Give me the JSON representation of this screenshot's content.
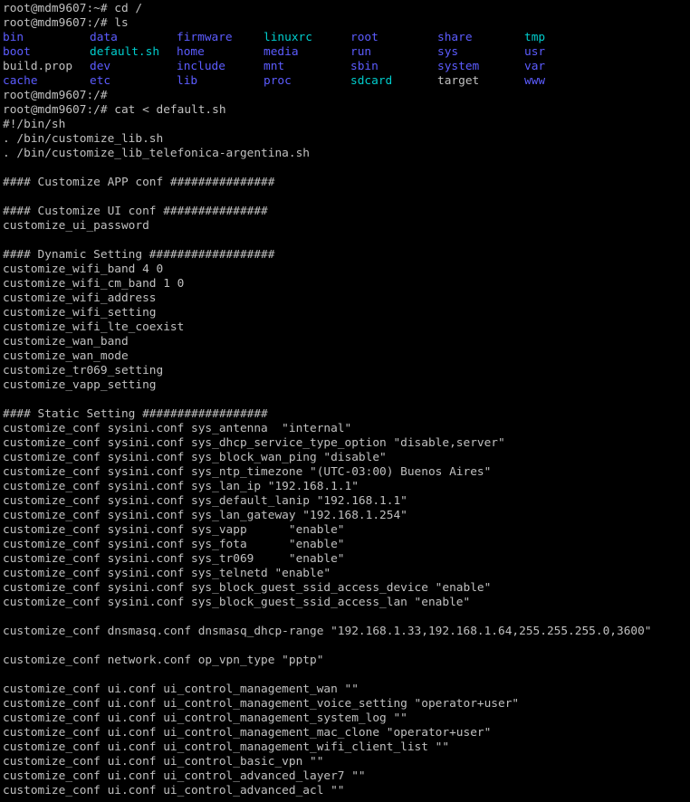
{
  "colors": {
    "background": "#000000",
    "text": "#c0c0c0",
    "directory": "#5c5cff",
    "executable": "#00cdcd",
    "symlink": "#00cdcd",
    "linkfile": "#00cdcd"
  },
  "session": [
    "root@mdm9607:~# cd /",
    "root@mdm9607:/# ls"
  ],
  "ls": {
    "rows": [
      [
        {
          "name": "bin",
          "kind": "dir"
        },
        {
          "name": "data",
          "kind": "dir"
        },
        {
          "name": "firmware",
          "kind": "dir"
        },
        {
          "name": "linuxrc",
          "kind": "link"
        },
        {
          "name": "root",
          "kind": "dir"
        },
        {
          "name": "share",
          "kind": "dir"
        },
        {
          "name": "tmp",
          "kind": "sticky"
        }
      ],
      [
        {
          "name": "boot",
          "kind": "dir"
        },
        {
          "name": "default.sh",
          "kind": "exec"
        },
        {
          "name": "home",
          "kind": "dir"
        },
        {
          "name": "media",
          "kind": "dir"
        },
        {
          "name": "run",
          "kind": "dir"
        },
        {
          "name": "sys",
          "kind": "dir"
        },
        {
          "name": "usr",
          "kind": "dir"
        }
      ],
      [
        {
          "name": "build.prop",
          "kind": "file"
        },
        {
          "name": "dev",
          "kind": "dir"
        },
        {
          "name": "include",
          "kind": "dir"
        },
        {
          "name": "mnt",
          "kind": "dir"
        },
        {
          "name": "sbin",
          "kind": "dir"
        },
        {
          "name": "system",
          "kind": "dir"
        },
        {
          "name": "var",
          "kind": "dir"
        }
      ],
      [
        {
          "name": "cache",
          "kind": "dir"
        },
        {
          "name": "etc",
          "kind": "dir"
        },
        {
          "name": "lib",
          "kind": "dir"
        },
        {
          "name": "proc",
          "kind": "dir"
        },
        {
          "name": "sdcard",
          "kind": "link"
        },
        {
          "name": "target",
          "kind": "file"
        },
        {
          "name": "www",
          "kind": "dir"
        }
      ]
    ]
  },
  "output": [
    "root@mdm9607:/#",
    "root@mdm9607:/# cat < default.sh",
    "#!/bin/sh",
    ". /bin/customize_lib.sh",
    ". /bin/customize_lib_telefonica-argentina.sh",
    "",
    "#### Customize APP conf ###############",
    "",
    "#### Customize UI conf ###############",
    "customize_ui_password",
    "",
    "#### Dynamic Setting ##################",
    "customize_wifi_band 4 0",
    "customize_wifi_cm_band 1 0",
    "customize_wifi_address",
    "customize_wifi_setting",
    "customize_wifi_lte_coexist",
    "customize_wan_band",
    "customize_wan_mode",
    "customize_tr069_setting",
    "customize_vapp_setting",
    "",
    "#### Static Setting ##################",
    "customize_conf sysini.conf sys_antenna  \"internal\"",
    "customize_conf sysini.conf sys_dhcp_service_type_option \"disable,server\"",
    "customize_conf sysini.conf sys_block_wan_ping \"disable\"",
    "customize_conf sysini.conf sys_ntp_timezone \"(UTC-03:00) Buenos Aires\"",
    "customize_conf sysini.conf sys_lan_ip \"192.168.1.1\"",
    "customize_conf sysini.conf sys_default_lanip \"192.168.1.1\"",
    "customize_conf sysini.conf sys_lan_gateway \"192.168.1.254\"",
    "customize_conf sysini.conf sys_vapp      \"enable\"",
    "customize_conf sysini.conf sys_fota      \"enable\"",
    "customize_conf sysini.conf sys_tr069     \"enable\"",
    "customize_conf sysini.conf sys_telnetd \"enable\"",
    "customize_conf sysini.conf sys_block_guest_ssid_access_device \"enable\"",
    "customize_conf sysini.conf sys_block_guest_ssid_access_lan \"enable\"",
    "",
    "customize_conf dnsmasq.conf dnsmasq_dhcp-range \"192.168.1.33,192.168.1.64,255.255.255.0,3600\"",
    "",
    "customize_conf network.conf op_vpn_type \"pptp\"",
    "",
    "customize_conf ui.conf ui_control_management_wan \"\"",
    "customize_conf ui.conf ui_control_management_voice_setting \"operator+user\"",
    "customize_conf ui.conf ui_control_management_system_log \"\"",
    "customize_conf ui.conf ui_control_management_mac_clone \"operator+user\"",
    "customize_conf ui.conf ui_control_management_wifi_client_list \"\"",
    "customize_conf ui.conf ui_control_basic_vpn \"\"",
    "customize_conf ui.conf ui_control_advanced_layer7 \"\"",
    "customize_conf ui.conf ui_control_advanced_acl \"\""
  ]
}
